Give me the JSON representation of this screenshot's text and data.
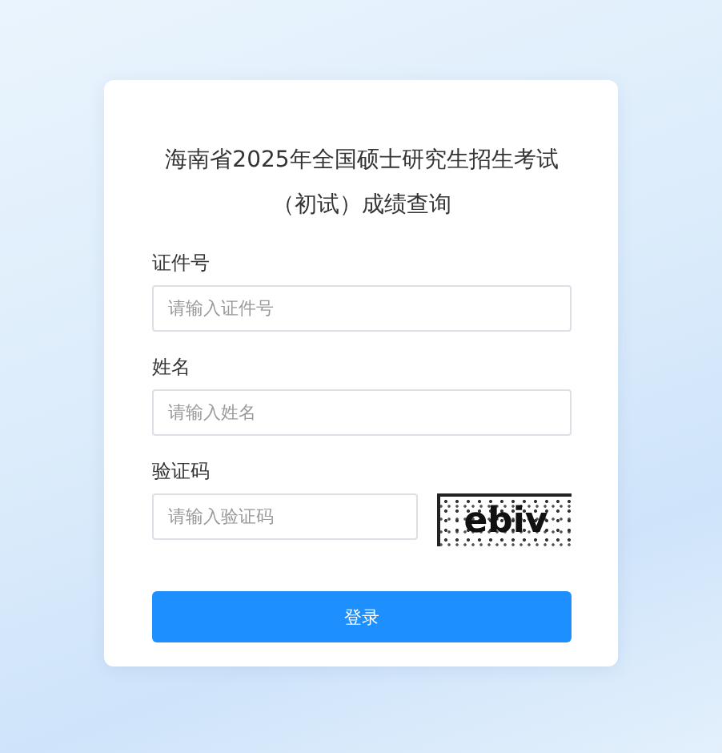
{
  "title_lines": [
    "海南省2025年全国硕士研究生招生考试",
    "（初试）成绩查询"
  ],
  "fields": [
    {
      "kind": "text",
      "label": "证件号",
      "placeholder": "请输入证件号"
    },
    {
      "kind": "text",
      "label": "姓名",
      "placeholder": "请输入姓名"
    },
    {
      "kind": "captcha",
      "label": "验证码",
      "placeholder": "请输入验证码",
      "code": "ebiv"
    }
  ],
  "submit": "登录"
}
